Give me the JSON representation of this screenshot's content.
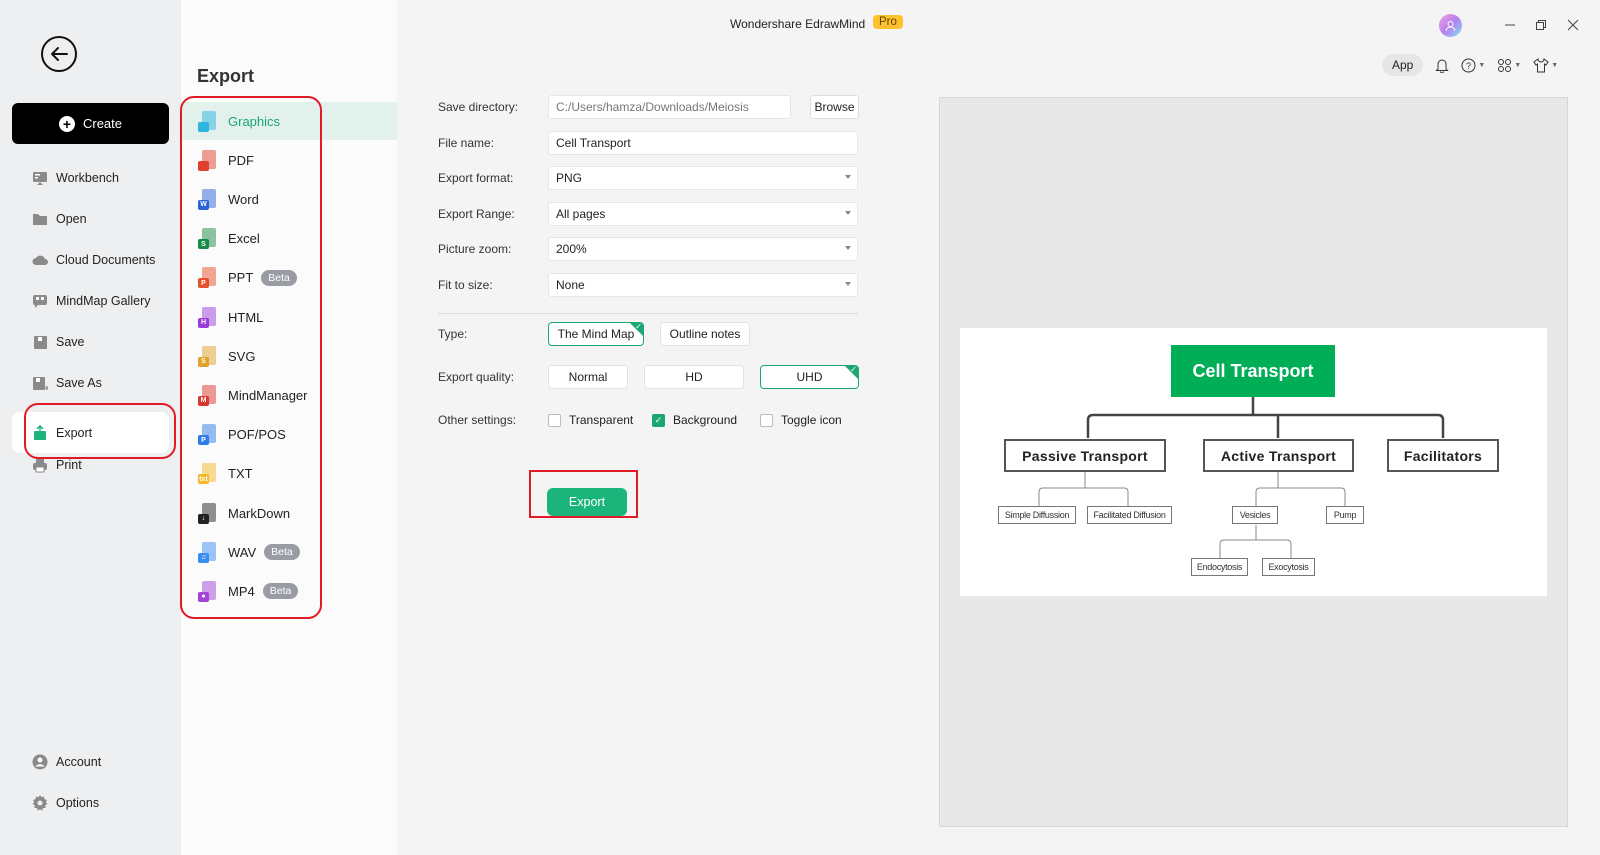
{
  "window": {
    "app_title": "Wondershare EdrawMind",
    "pro_badge": "Pro",
    "app_button": "App"
  },
  "leftnav": {
    "create_label": "Create",
    "items": [
      {
        "label": "Workbench",
        "icon": "workbench-icon"
      },
      {
        "label": "Open",
        "icon": "folder-icon"
      },
      {
        "label": "Cloud Documents",
        "icon": "cloud-icon"
      },
      {
        "label": "MindMap Gallery",
        "icon": "gallery-icon"
      },
      {
        "label": "Save",
        "icon": "save-icon"
      },
      {
        "label": "Save As",
        "icon": "save-as-icon"
      },
      {
        "label": "Export",
        "icon": "export-icon",
        "active": true
      },
      {
        "label": "Print",
        "icon": "print-icon"
      }
    ],
    "bottom_items": [
      {
        "label": "Account",
        "icon": "account-icon"
      },
      {
        "label": "Options",
        "icon": "gear-icon"
      }
    ]
  },
  "export_types": {
    "title": "Export",
    "items": [
      {
        "label": "Graphics",
        "tag": "",
        "color": "#2bb5e0",
        "active": true
      },
      {
        "label": "PDF",
        "tag": "",
        "color": "#e2402e"
      },
      {
        "label": "Word",
        "tag": "W",
        "color": "#2b62d6"
      },
      {
        "label": "Excel",
        "tag": "S",
        "color": "#1a8a4a"
      },
      {
        "label": "PPT",
        "tag": "P",
        "color": "#e5512b",
        "badge": "Beta"
      },
      {
        "label": "HTML",
        "tag": "H",
        "color": "#9a3dd8"
      },
      {
        "label": "SVG",
        "tag": "S",
        "color": "#e0a22a"
      },
      {
        "label": "MindManager",
        "tag": "M",
        "color": "#d9382e"
      },
      {
        "label": "POF/POS",
        "tag": "P",
        "color": "#2f7de8"
      },
      {
        "label": "TXT",
        "tag": "txt",
        "color": "#f5b82a"
      },
      {
        "label": "MarkDown",
        "tag": "↓",
        "color": "#222222"
      },
      {
        "label": "WAV",
        "tag": "♫",
        "color": "#3a8ef0",
        "badge": "Beta"
      },
      {
        "label": "MP4",
        "tag": "●",
        "color": "#a244d8",
        "badge": "Beta"
      }
    ]
  },
  "settings": {
    "save_directory": {
      "label": "Save directory:",
      "value": "C:/Users/hamza/Downloads/Meiosis",
      "browse": "Browse"
    },
    "file_name": {
      "label": "File name:",
      "value": "Cell Transport"
    },
    "export_format": {
      "label": "Export format:",
      "value": "PNG"
    },
    "export_range": {
      "label": "Export Range:",
      "value": "All pages"
    },
    "picture_zoom": {
      "label": "Picture zoom:",
      "value": "200%"
    },
    "fit_to_size": {
      "label": "Fit to size:",
      "value": "None"
    },
    "type": {
      "label": "Type:",
      "options": [
        "The Mind Map",
        "Outline notes"
      ],
      "selected": "The Mind Map"
    },
    "export_quality": {
      "label": "Export quality:",
      "options": [
        "Normal",
        "HD",
        "UHD"
      ],
      "selected": "UHD"
    },
    "other_settings": {
      "label": "Other settings:",
      "options": [
        {
          "label": "Transparent",
          "checked": false
        },
        {
          "label": "Background",
          "checked": true
        },
        {
          "label": "Toggle icon",
          "checked": false
        }
      ]
    },
    "export_button": "Export"
  },
  "preview": {
    "root": "Cell Transport",
    "branches": [
      {
        "label": "Passive Transport",
        "children": [
          "Simple Diffussion",
          "Facilitated Diffusion"
        ]
      },
      {
        "label": "Active Transport",
        "children": [
          "Vesicles",
          "Pump"
        ],
        "grandchildren": [
          "Endocytosis",
          "Exocytosis"
        ]
      },
      {
        "label": "Facilitators",
        "children": []
      }
    ]
  },
  "colors": {
    "accent": "#1bb57c",
    "root_node": "#00ae57",
    "highlight": "#e01b24",
    "pro": "#fcc22e"
  }
}
